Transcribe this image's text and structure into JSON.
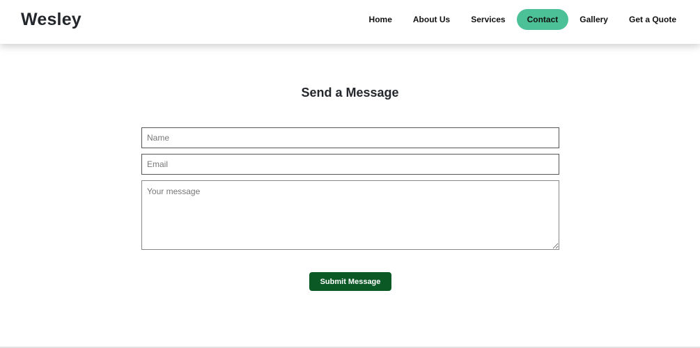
{
  "header": {
    "logo": "Wesley",
    "nav": [
      {
        "label": "Home",
        "active": false
      },
      {
        "label": "About Us",
        "active": false
      },
      {
        "label": "Services",
        "active": false
      },
      {
        "label": "Contact",
        "active": true
      },
      {
        "label": "Gallery",
        "active": false
      },
      {
        "label": "Get a Quote",
        "active": false
      }
    ]
  },
  "form": {
    "title": "Send a Message",
    "name": {
      "placeholder": "Name",
      "value": ""
    },
    "email": {
      "placeholder": "Email",
      "value": ""
    },
    "message": {
      "placeholder": "Your message",
      "value": ""
    },
    "submit_label": "Submit Message"
  },
  "colors": {
    "accent": "#4cc198",
    "button": "#0b5a26",
    "text": "#23262b"
  }
}
